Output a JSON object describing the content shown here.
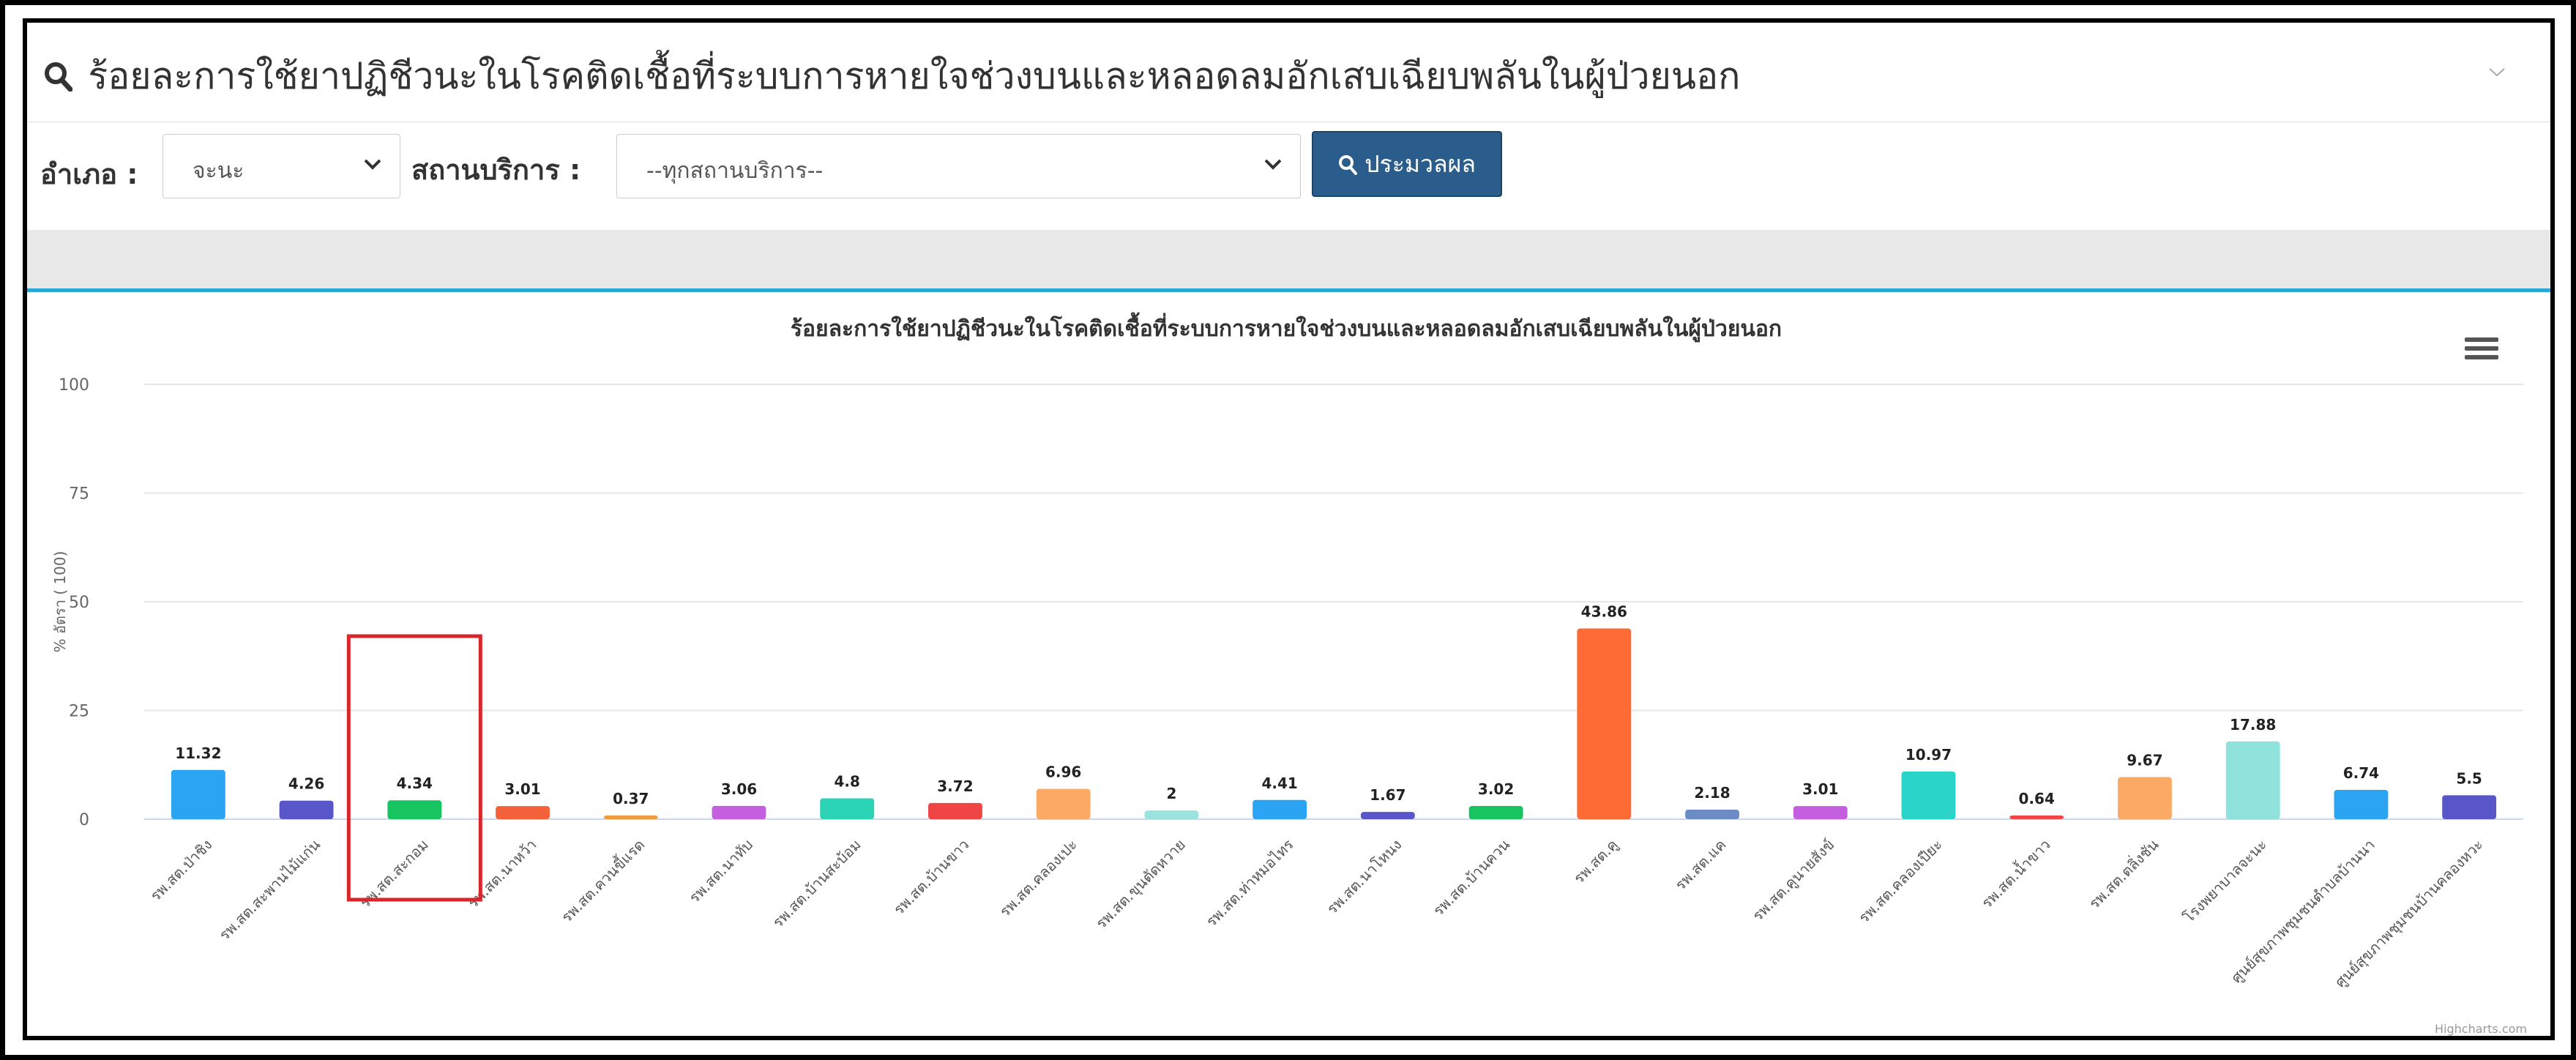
{
  "header": {
    "title": "ร้อยละการใช้ยาปฏิชีวนะในโรคติดเชื้อที่ระบบการหายใจช่วงบนและหลอดลมอักเสบเฉียบพลันในผู้ป่วยนอก",
    "title_icon": "search-icon",
    "collapse_icon": "chevron-down-icon"
  },
  "filters": {
    "district_label": "อำเภอ :",
    "district_value": "จะนะ",
    "service_label": "สถานบริการ :",
    "service_value": "--ทุกสถานบริการ--",
    "process_button": "ประมวลผล"
  },
  "chart_menu_icon": "hamburger-icon",
  "credits": "Highcharts.com",
  "highlight_color": "#d9262b",
  "chart_data": {
    "type": "bar",
    "title": "ร้อยละการใช้ยาปฏิชีวนะในโรคติดเชื้อที่ระบบการหายใจช่วงบนและหลอดลมอักเสบเฉียบพลันในผู้ป่วยนอก",
    "ylabel": "% อัตรา ( 100)",
    "ylim": [
      0,
      100
    ],
    "yticks": [
      0,
      25,
      50,
      75,
      100
    ],
    "grid": true,
    "categories": [
      "รพ.สต.ป่าชิง",
      "รพ.สต.สะพานไม้แก่น",
      "รพ.สต.สะกอม",
      "รพ.สต.นาหว้า",
      "รพ.สต.ควนขี้แรด",
      "รพ.สต.นาทับ",
      "รพ.สต.บ้านสะบ้อม",
      "รพ.สต.บ้านขาว",
      "รพ.สต.คลองเปะ",
      "รพ.สต.ขุนตัดหวาย",
      "รพ.สต.ท่าหมอไทร",
      "รพ.สต.นาโหนง",
      "รพ.สต.บ้านควน",
      "รพ.สต.คู",
      "รพ.สต.แค",
      "รพ.สต.คูนายสังข์",
      "รพ.สต.คลองเปียะ",
      "รพ.สต.น้ำขาว",
      "รพ.สต.ตลิ่งชัน",
      "โรงพยาบาลจะนะ",
      "ศูนย์สุขภาพชุมชนตำบลบ้านนา",
      "ศูนย์สุขภาพชุมชนบ้านคลองหวะ"
    ],
    "values": [
      11.32,
      4.26,
      4.34,
      3.01,
      0.37,
      3.06,
      4.8,
      3.72,
      6.96,
      2,
      4.41,
      1.67,
      3.02,
      43.86,
      2.18,
      3.01,
      10.97,
      0.64,
      9.67,
      17.88,
      6.74,
      5.5
    ],
    "value_labels": [
      "11.32",
      "4.26",
      "4.34",
      "3.01",
      "0.37",
      "3.06",
      "4.8",
      "3.72",
      "6.96",
      "2",
      "4.41",
      "1.67",
      "3.02",
      "43.86",
      "2.18",
      "3.01",
      "10.97",
      "0.64",
      "9.67",
      "17.88",
      "6.74",
      "5.5"
    ],
    "colors": [
      "#2ba4f4",
      "#5856c8",
      "#17c45f",
      "#f4613a",
      "#f29b3a",
      "#c45fe0",
      "#2bd4b4",
      "#f04545",
      "#fbaa66",
      "#9be3de",
      "#2ba4f4",
      "#5856c8",
      "#17c45f",
      "#ff6b35",
      "#6b8cc4",
      "#c45fe0",
      "#2bd4c8",
      "#f04545",
      "#fbaa66",
      "#8fe3dc",
      "#2ba4f4",
      "#5856c8"
    ],
    "highlighted_category_index": 2
  }
}
